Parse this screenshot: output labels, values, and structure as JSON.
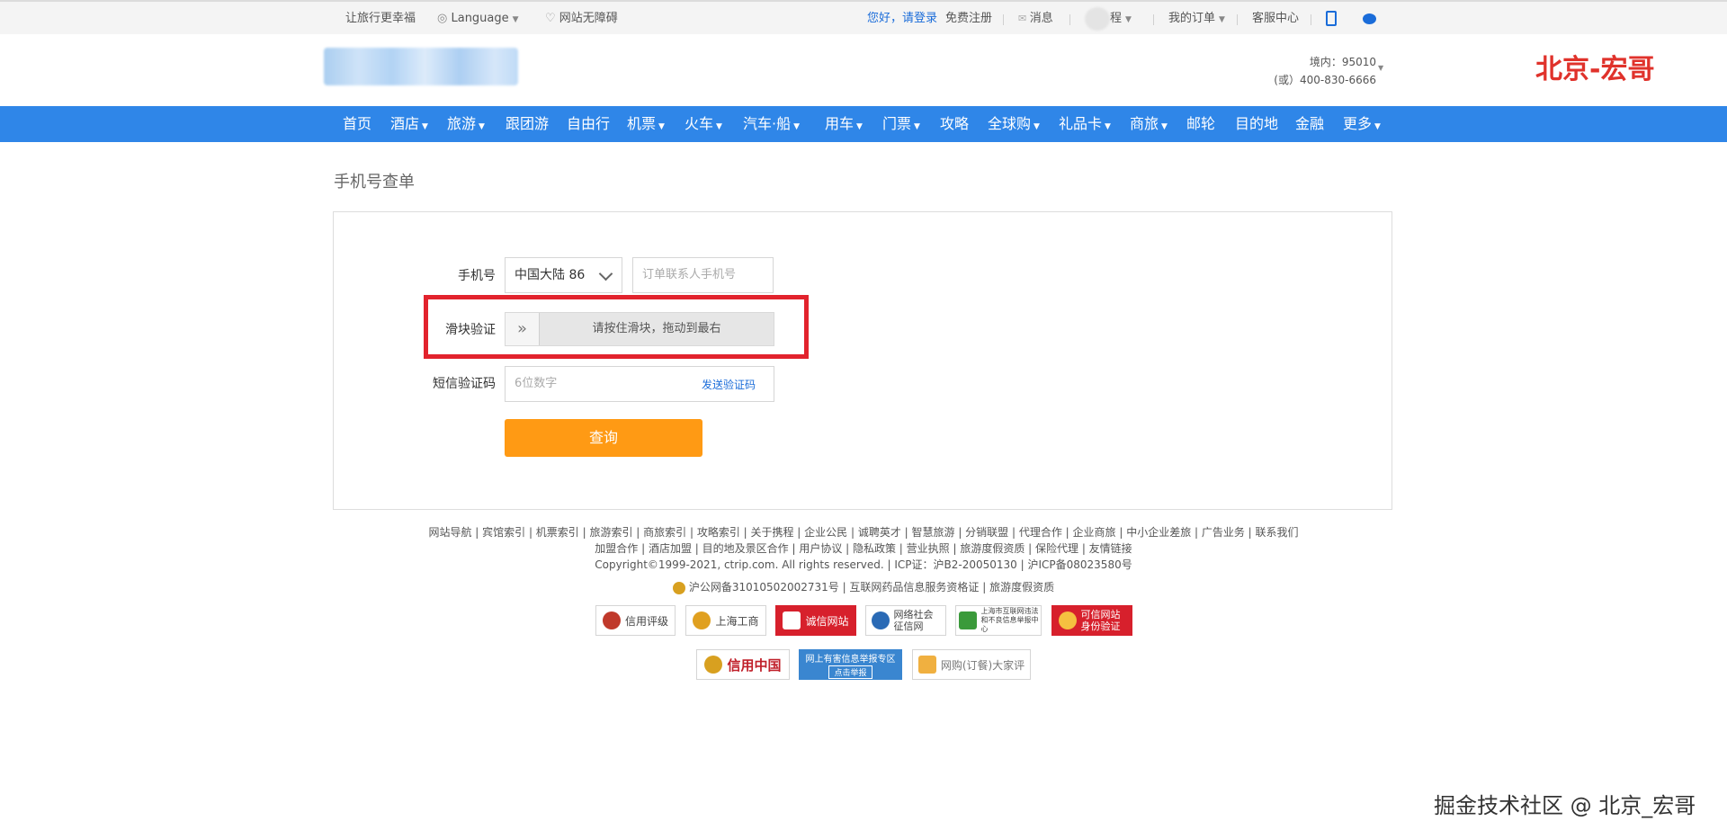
{
  "topbar": {
    "slogan": "让旅行更幸福",
    "language": "Language",
    "accessibility": "网站无障碍",
    "greeting": "您好，请登录",
    "register": "免费注册",
    "messages": "消息",
    "my_ctrip": "程",
    "my_orders": "我的订单",
    "service": "客服中心"
  },
  "header": {
    "hotline_domestic": "境内：95010",
    "hotline_alt": "(或）400-830-6666",
    "brand_overlay": "北京-宏哥"
  },
  "nav": {
    "items": [
      "首页",
      "酒店",
      "旅游",
      "跟团游",
      "自由行",
      "机票",
      "火车",
      "汽车·船",
      "用车",
      "门票",
      "攻略",
      "全球购",
      "礼品卡",
      "商旅",
      "邮轮",
      "目的地",
      "金融",
      "更多"
    ]
  },
  "page": {
    "title": "手机号查单"
  },
  "form": {
    "phone_label": "手机号",
    "country_value": "中国大陆 86",
    "phone_placeholder": "订单联系人手机号",
    "slider_label": "滑块验证",
    "slider_text": "请按住滑块，拖动到最右",
    "sms_label": "短信验证码",
    "sms_placeholder": "6位数字",
    "send_code": "发送验证码",
    "query_button": "查询"
  },
  "footer": {
    "links_line1": "网站导航 | 宾馆索引 | 机票索引 | 旅游索引 | 商旅索引 | 攻略索引 | 关于携程 | 企业公民 | 诚聘英才 | 智慧旅游  | 分销联盟 | 代理合作 | 企业商旅 | 中小企业差旅 | 广告业务 | 联系我们",
    "links_line2": "加盟合作 | 酒店加盟 | 目的地及景区合作 | 用户协议 | 隐私政策 | 营业执照 | 旅游度假资质 | 保险代理 | 友情链接",
    "copyright": "Copyright©1999-2021, ctrip.com. All rights reserved. | ICP证：沪B2-20050130 | 沪ICP备08023580号",
    "license": "沪公网备31010502002731号 | 互联网药品信息服务资格证 | 旅游度假资质",
    "badges_row1": [
      "信用评级",
      "上海工商",
      "诚信网站",
      "网络社会征信网",
      "上海市互联网违法和不良信息举报中心",
      "可信网站身份验证"
    ],
    "badges_row2": [
      "信用中国",
      "网上有害信息举报专区",
      "网购(订餐)大家评"
    ],
    "badge_subtext": "点击举报"
  },
  "watermark": "掘金技术社区 @ 北京_宏哥",
  "colors": {
    "nav_blue": "#2f86e8",
    "query_orange": "#ff9a14",
    "highlight_red": "#e2232d",
    "link_blue": "#1a6cd9"
  }
}
